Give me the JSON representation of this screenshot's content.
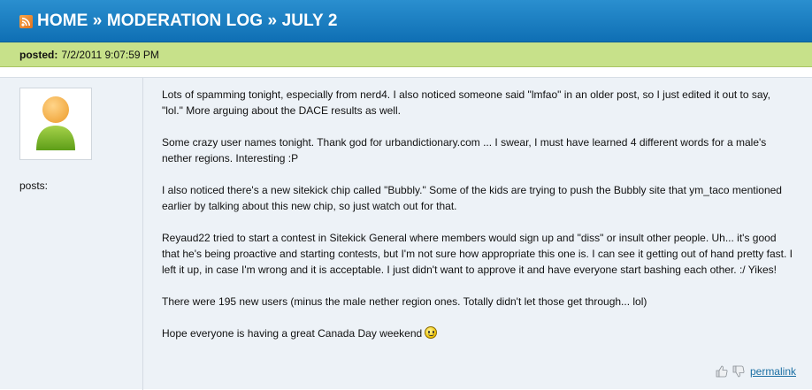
{
  "header": {
    "crumbs": [
      "HOME",
      "MODERATION LOG",
      "JULY 2"
    ],
    "separator": "»"
  },
  "post": {
    "posted_label": "posted:",
    "posted_value": "7/2/2011 9:07:59 PM",
    "posts_label": "posts:",
    "paragraphs": [
      "Lots of spamming tonight, especially from nerd4. I also noticed someone said \"lmfao\" in an older post, so I just edited it out to say, \"lol.\" More arguing about the DACE results as well.",
      "Some crazy user names tonight. Thank god for urbandictionary.com ... I swear, I must have learned 4 different words for a male's nether regions. Interesting :P",
      "I also noticed there's a new sitekick chip called \"Bubbly.\" Some of the kids are trying to push the Bubbly site that ym_taco mentioned earlier by talking about this new chip, so just watch out for that.",
      "Reyaud22 tried to start a contest in Sitekick General where members would sign up and \"diss\" or insult other people. Uh... it's good that he's being proactive and starting contests, but I'm not sure how appropriate this one is. I can see it getting out of hand pretty fast. I left it up, in case I'm wrong and it is acceptable. I just didn't want to approve it and have everyone start bashing each other. :/ Yikes!",
      "There were 195 new users (minus the male nether region ones. Totally didn't let those get through... lol)",
      "Hope everyone is having a great Canada Day weekend"
    ],
    "permalink_label": "permalink",
    "icons": {
      "rss": "rss-icon",
      "avatar": "user-avatar-icon",
      "smiley": "smiley-icon",
      "thumb_up": "thumbs-up-icon",
      "thumb_down": "thumbs-down-icon"
    }
  },
  "colors": {
    "header_top": "#2a8fcf",
    "header_bottom": "#0f6fb4",
    "post_bar": "#c7e18a",
    "body_bg": "#edf2f7",
    "link": "#1a6fa3"
  }
}
